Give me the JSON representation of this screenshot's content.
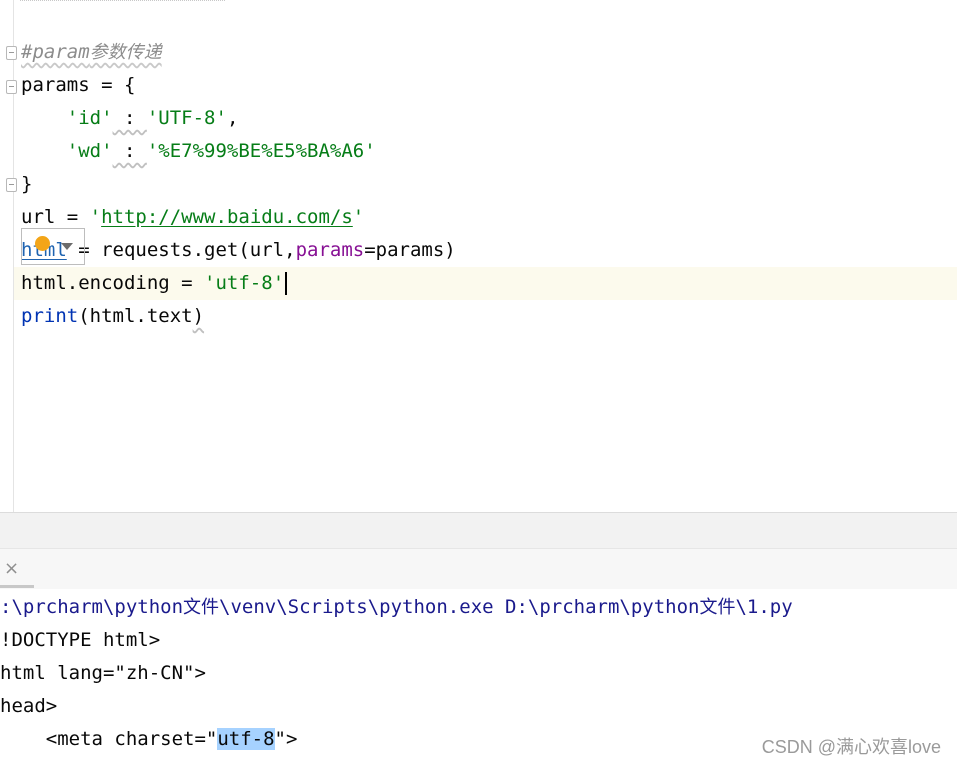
{
  "editor": {
    "comment_hash": "#param",
    "comment_cn": "参数传递",
    "line_params_open": "params = {",
    "dict_key1": "'id'",
    "dict_colon": " : ",
    "dict_val1": "'UTF-8'",
    "comma": ",",
    "dict_key2": "'wd'",
    "dict_val2": "'%E7%99%BE%E5%BA%A6'",
    "line_close_brace": "}",
    "url_var": "url",
    "assign": " = ",
    "quote": "'",
    "url_value": "http://www.baidu.com/s",
    "html_var": "html",
    "requests_call": "requests.get(url,",
    "params_kw": "params",
    "params_rest": "=params)",
    "encoding_lhs": "html.encoding",
    "encoding_val": "'utf-8",
    "print_fn": "print",
    "print_arg": "(html.text",
    "print_close": ")"
  },
  "intention": {
    "icon": "lightbulb-icon"
  },
  "run_panel": {
    "close_icon": "×"
  },
  "console": {
    "cmd_part1": ":\\prcharm\\python",
    "cmd_cn1": "文件",
    "cmd_part2": "\\venv\\Scripts\\python.exe D:\\prcharm\\python",
    "cmd_cn2": "文件",
    "cmd_part3": "\\1.py",
    "line_doctype": "!DOCTYPE html>",
    "line_html": "html lang=\"zh-CN\">",
    "line_head": "head>",
    "meta_pre": "    <meta charset=\"",
    "meta_sel": "utf-8",
    "meta_post": "\">"
  },
  "watermark": "CSDN @满心欢喜love",
  "colors": {
    "string": "#067d17",
    "keyword_arg": "#871094",
    "builtin": "#0033b3",
    "selection": "#a6d2ff",
    "current_line": "#fcfaed"
  }
}
